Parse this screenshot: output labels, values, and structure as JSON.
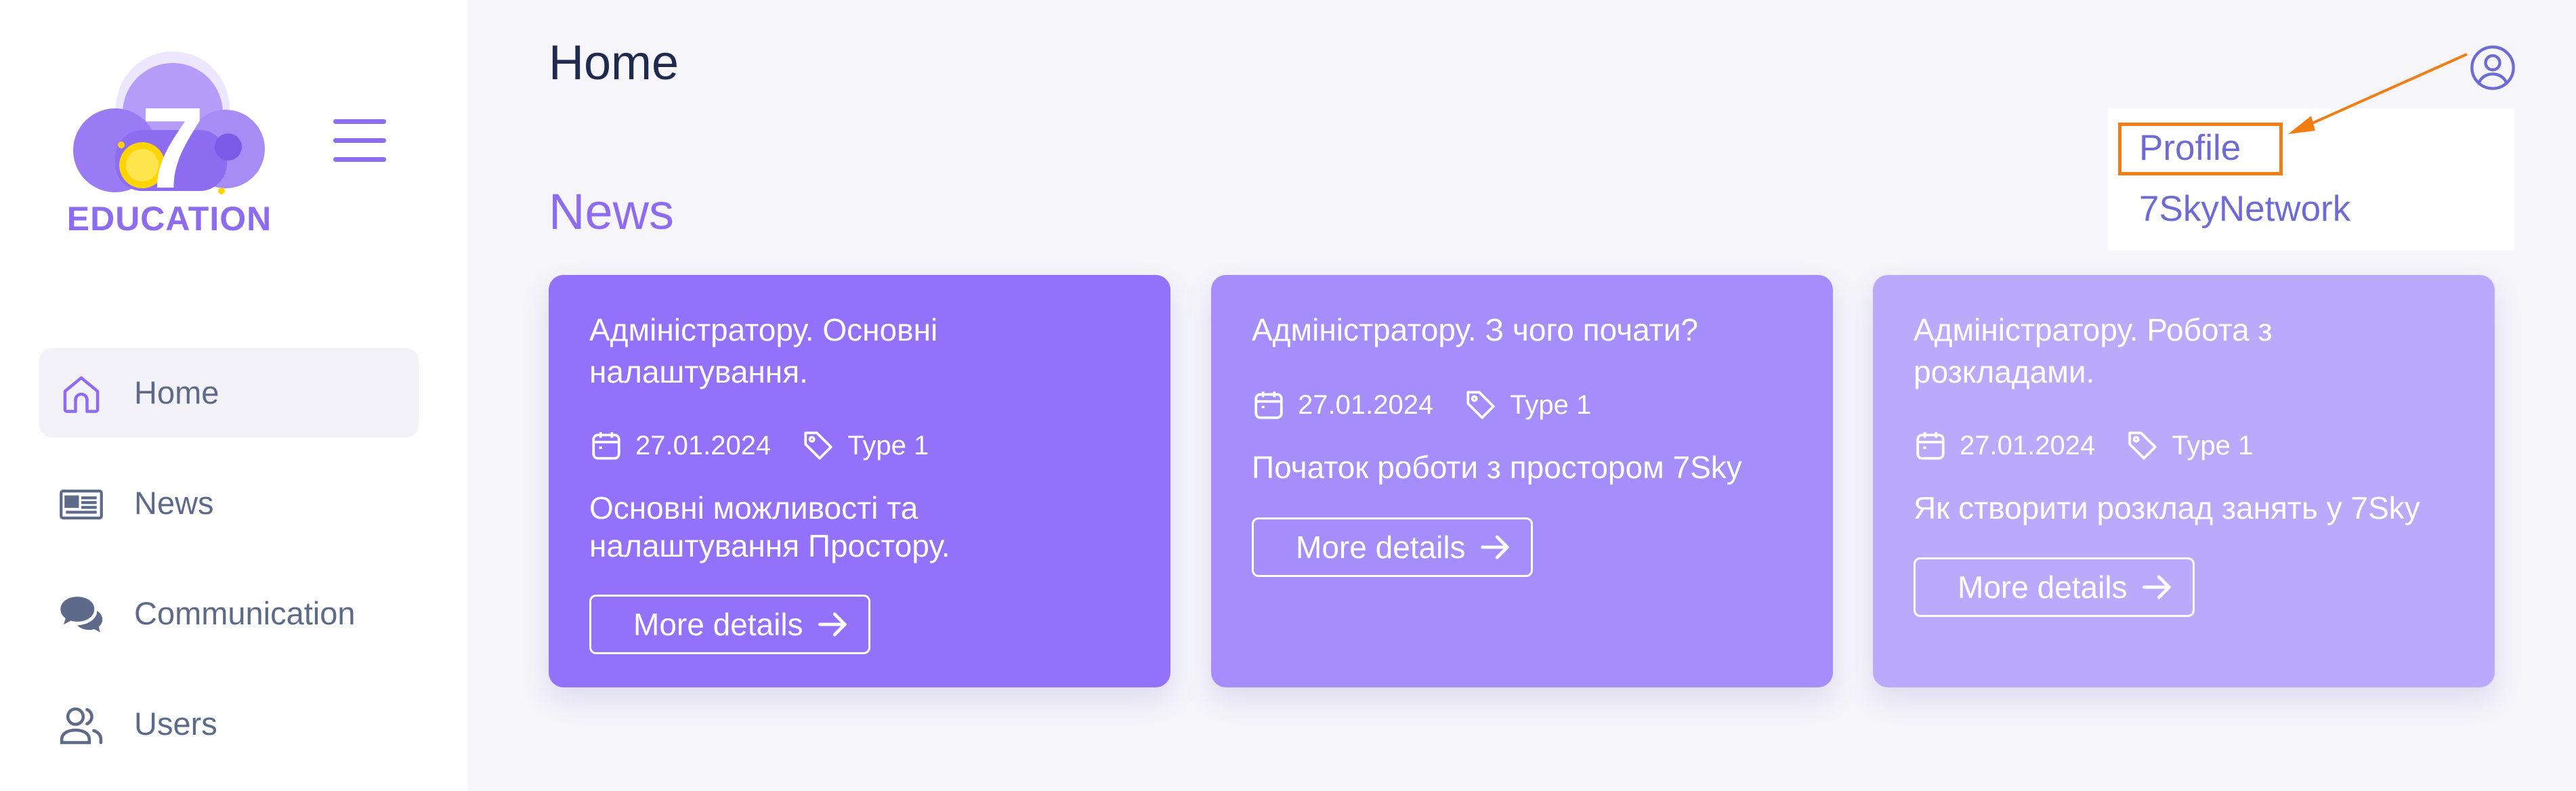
{
  "colors": {
    "accent": "#8d6cf0",
    "card_1": "#9371fb",
    "card_2": "#a58dfb",
    "card_3": "#bbaafb",
    "highlight": "#f07e14"
  },
  "logo": {
    "badge": "7",
    "text": "EDUCATION"
  },
  "sidebar": {
    "items": [
      {
        "label": "Home",
        "icon": "home-icon",
        "active": true
      },
      {
        "label": "News",
        "icon": "newspaper-icon"
      },
      {
        "label": "Communication",
        "icon": "chat-icon"
      },
      {
        "label": "Users",
        "icon": "users-icon"
      }
    ]
  },
  "header": {
    "title": "Home"
  },
  "main": {
    "section_title": "News"
  },
  "user_menu": {
    "icon": "user-circle-icon",
    "items": [
      "Profile",
      "7SkyNetwork"
    ]
  },
  "cards": [
    {
      "title": "Адміністратору. Основні налаштування.",
      "date": "27.01.2024",
      "type": "Type 1",
      "description": "Основні можливості та налаштування Простору.",
      "button": "More details"
    },
    {
      "title": "Адміністратору. З чого почати?",
      "date": "27.01.2024",
      "type": "Type 1",
      "description": "Початок роботи з простором 7Sky",
      "button": "More details"
    },
    {
      "title": "Адміністратору. Робота з розкладами.",
      "date": "27.01.2024",
      "type": "Type 1",
      "description": "Як створити розклад занять у 7Sky",
      "button": "More details"
    }
  ]
}
